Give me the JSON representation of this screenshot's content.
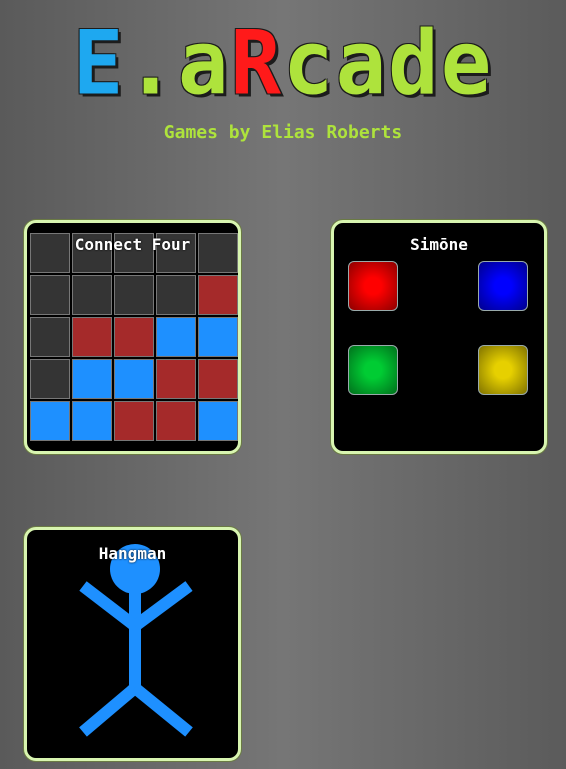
{
  "header": {
    "logo_letters": [
      {
        "char": "E",
        "color": "#1ea8f0"
      },
      {
        "char": ".",
        "color": "#aee33c"
      },
      {
        "char": "a",
        "color": "#aee33c"
      },
      {
        "char": "R",
        "color": "#ff1a1a"
      },
      {
        "char": "c",
        "color": "#aee33c"
      },
      {
        "char": "a",
        "color": "#aee33c"
      },
      {
        "char": "d",
        "color": "#aee33c"
      },
      {
        "char": "e",
        "color": "#aee33c"
      }
    ],
    "subtitle": "Games by Elias Roberts"
  },
  "games": {
    "connect_four": {
      "title": "Connect Four",
      "board": [
        [
          "empty",
          "empty",
          "empty",
          "empty",
          "empty"
        ],
        [
          "empty",
          "empty",
          "empty",
          "empty",
          "red"
        ],
        [
          "empty",
          "red",
          "red",
          "blue",
          "blue"
        ],
        [
          "empty",
          "blue",
          "blue",
          "red",
          "red"
        ],
        [
          "blue",
          "blue",
          "red",
          "red",
          "blue"
        ]
      ],
      "colors": {
        "empty": "#343434",
        "red": "#a52a2a",
        "blue": "#1e90ff"
      }
    },
    "simone": {
      "title": "Simōne",
      "pads": [
        {
          "name": "red",
          "color": "#ff0000"
        },
        {
          "name": "blue",
          "color": "#0000ff"
        },
        {
          "name": "green",
          "color": "#00cc33"
        },
        {
          "name": "yellow",
          "color": "#e6d000"
        }
      ]
    },
    "hangman": {
      "title": "Hangman",
      "figure_color": "#1e90ff",
      "icon": "stick-figure-icon"
    }
  }
}
